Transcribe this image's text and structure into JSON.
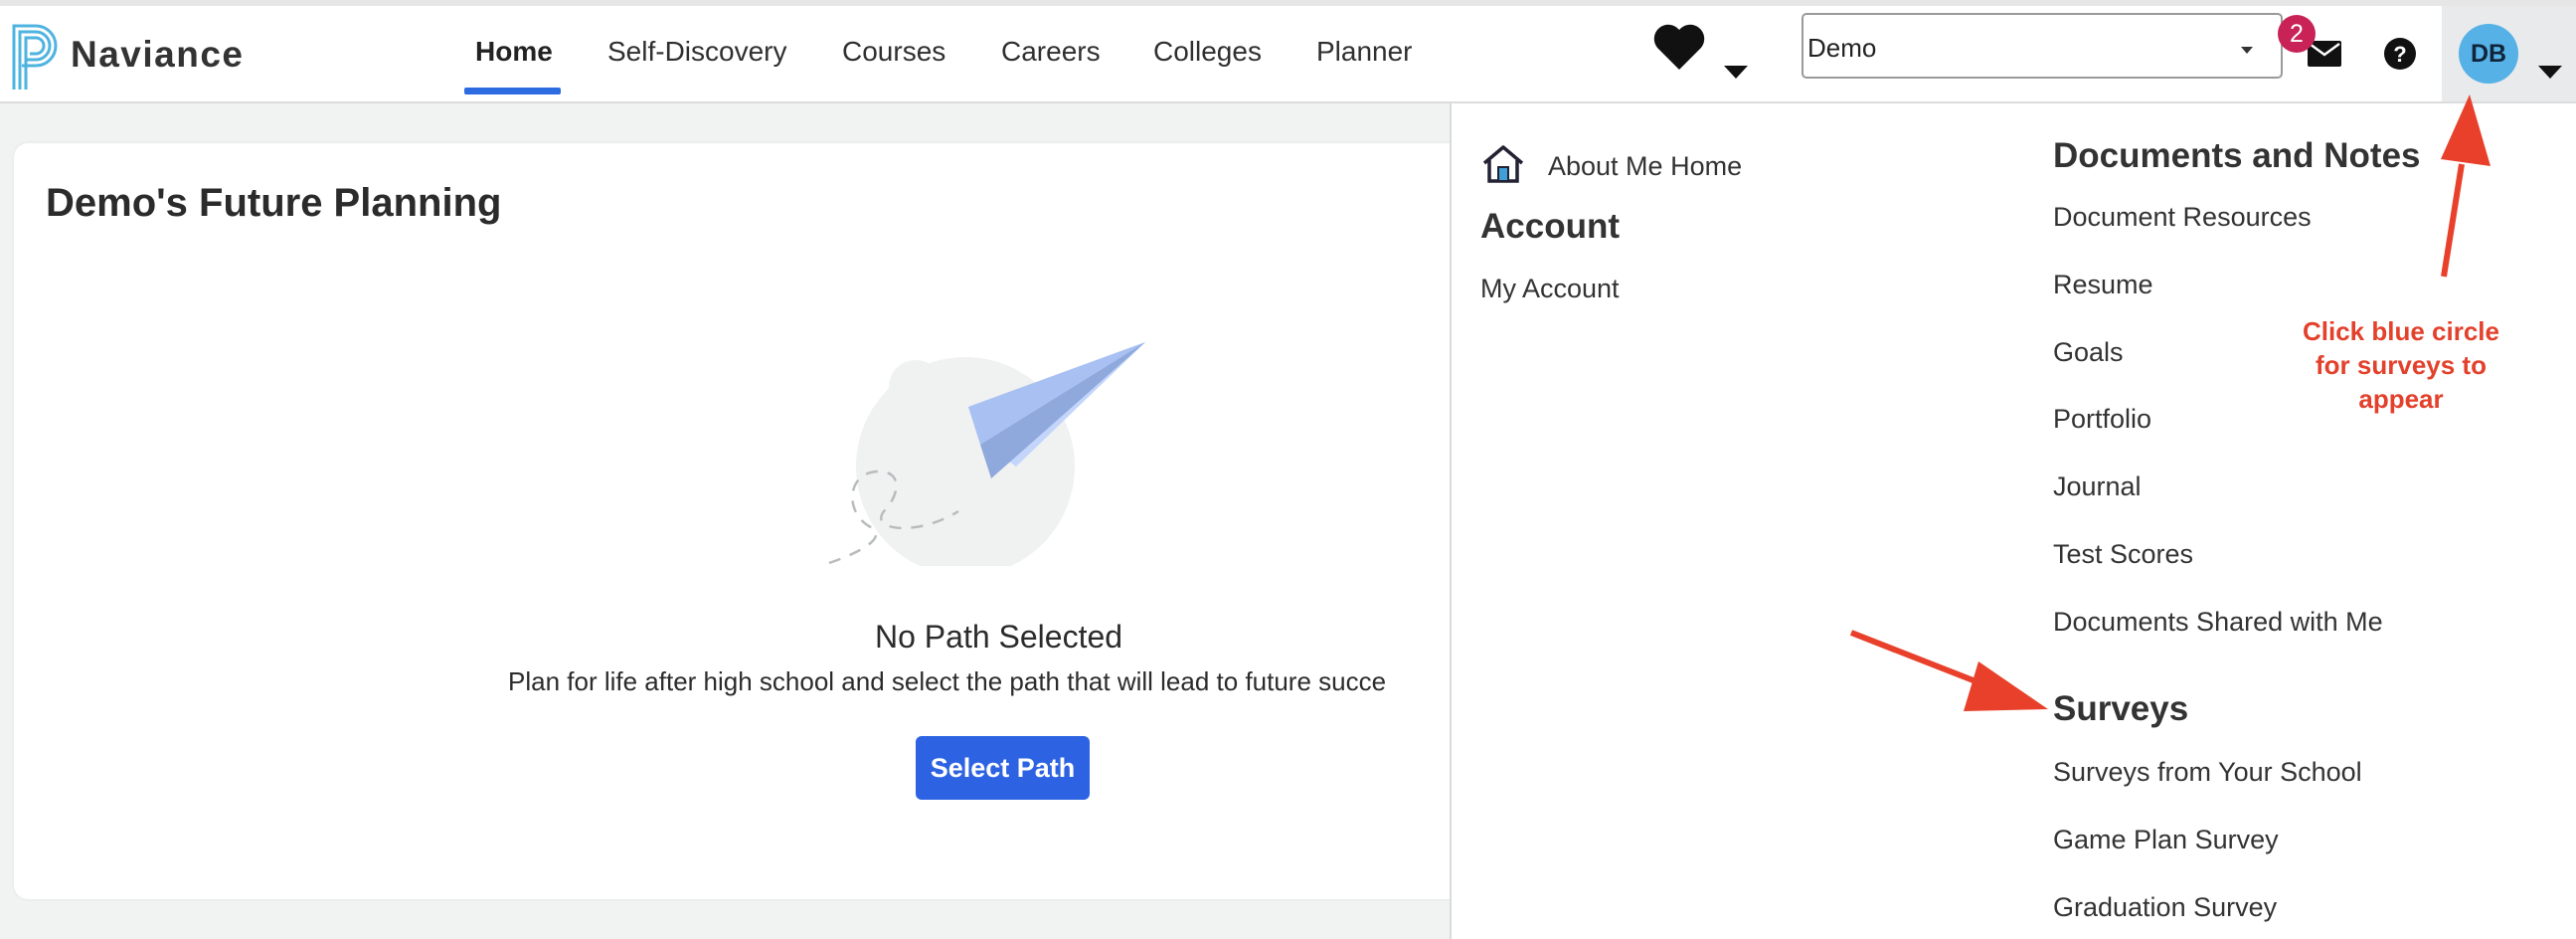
{
  "brand": {
    "name": "Naviance"
  },
  "nav": {
    "items": [
      {
        "label": "Home",
        "active": true
      },
      {
        "label": "Self-Discovery"
      },
      {
        "label": "Courses"
      },
      {
        "label": "Careers"
      },
      {
        "label": "Colleges"
      },
      {
        "label": "Planner"
      }
    ]
  },
  "header": {
    "student_select_value": "Demo",
    "notification_count": "2",
    "avatar_initials": "DB"
  },
  "card": {
    "title": "Demo's Future Planning",
    "empty_title": "No Path Selected",
    "empty_description": "Plan for life after high school and select the path that will lead to future succe",
    "button_label": "Select Path"
  },
  "dropdown": {
    "about_me_home": "About Me Home",
    "account_heading": "Account",
    "my_account": "My Account",
    "documents_heading": "Documents and Notes",
    "documents": [
      "Document Resources",
      "Resume",
      "Goals",
      "Portfolio",
      "Journal",
      "Test Scores",
      "Documents Shared with Me"
    ],
    "surveys_heading": "Surveys",
    "surveys": [
      "Surveys from Your School",
      "Game Plan Survey",
      "Graduation Survey"
    ]
  },
  "annotation": {
    "line1": "Click blue circle",
    "line2": "for surveys to",
    "line3": "appear"
  },
  "colors": {
    "accent_blue": "#2d63e3",
    "avatar_blue": "#55b1e6",
    "badge_red": "#c82257",
    "annotation_red": "#e3412c"
  }
}
